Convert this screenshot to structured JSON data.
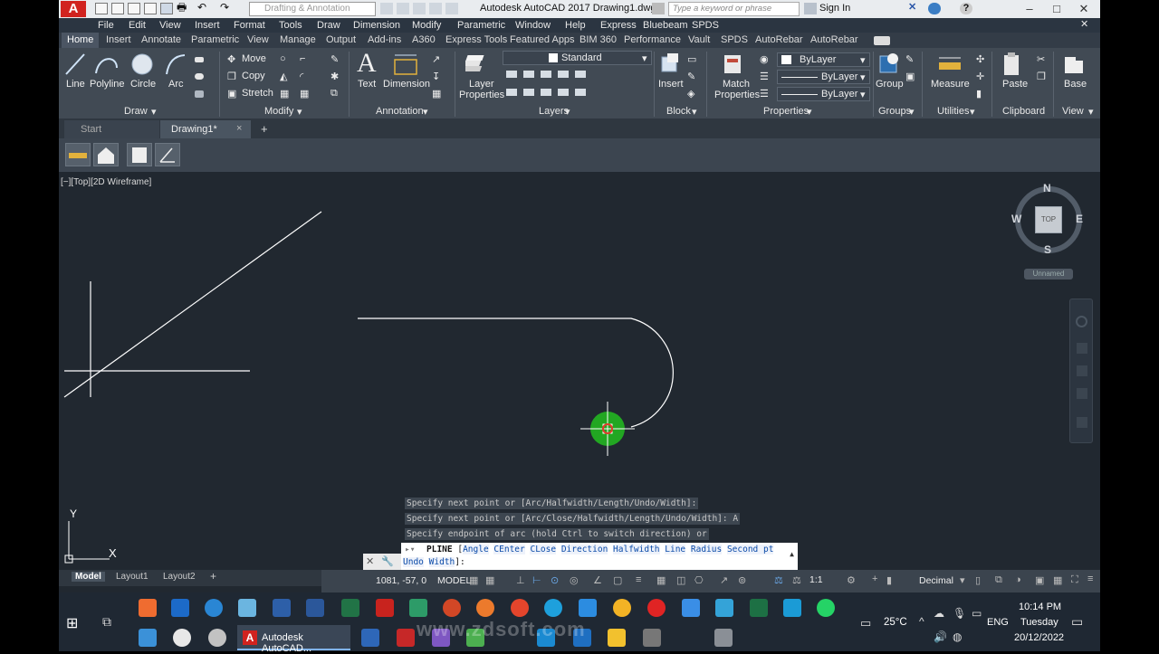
{
  "window": {
    "app_logo": "A",
    "title": "Autodesk AutoCAD 2017   Drawing1.dwg",
    "workspace": "Drafting & Annotation",
    "search_placeholder": "Type a keyword or phrase",
    "signin": "Sign In",
    "controls": [
      "–",
      "□",
      "✕"
    ]
  },
  "menubar": [
    "File",
    "Edit",
    "View",
    "Insert",
    "Format",
    "Tools",
    "Draw",
    "Dimension",
    "Modify",
    "Parametric",
    "Window",
    "Help",
    "Express",
    "Bluebeam",
    "SPDS"
  ],
  "ribbon_tabs": [
    "Home",
    "Insert",
    "Annotate",
    "Parametric",
    "View",
    "Manage",
    "Output",
    "Add-ins",
    "A360",
    "Express Tools",
    "Featured Apps",
    "BIM 360",
    "Performance",
    "Vault",
    "SPDS",
    "AutoRebar",
    "AutoRebar"
  ],
  "ribbon": {
    "draw": {
      "title": "Draw",
      "tools": [
        "Line",
        "Polyline",
        "Circle",
        "Arc"
      ]
    },
    "modify": {
      "title": "Modify",
      "tools": [
        "Move",
        "Copy",
        "Stretch"
      ]
    },
    "annotation": {
      "title": "Annotation",
      "tools": [
        "Text",
        "Dimension"
      ]
    },
    "layers": {
      "title": "Layers",
      "tool": "Layer",
      "tool2": "Properties",
      "layer_name": "Standard"
    },
    "block": {
      "title": "Block",
      "tool": "Insert"
    },
    "properties": {
      "title": "Properties",
      "tool": "Match",
      "tool2": "Properties",
      "color": "ByLayer",
      "linetype": "ByLayer",
      "lineweight": "ByLayer"
    },
    "groups": {
      "title": "Groups",
      "tool": "Group"
    },
    "utilities": {
      "title": "Utilities",
      "tool": "Measure"
    },
    "clipboard": {
      "title": "Clipboard",
      "tool": "Paste"
    },
    "view": {
      "title": "View",
      "tool": "Base"
    }
  },
  "file_tabs": {
    "start": "Start",
    "drawing": "Drawing1*",
    "close": "×",
    "add": "+"
  },
  "viewport": {
    "label": "[−][Top][2D Wireframe]",
    "viewcube": {
      "n": "N",
      "s": "S",
      "e": "E",
      "w": "W",
      "face": "TOP",
      "ucs": "Unnamed"
    },
    "ucs_axis": {
      "x": "X",
      "y": "Y"
    }
  },
  "command": {
    "history": [
      "Specify next point or [Arc/Halfwidth/Length/Undo/Width]:",
      "Specify next point or [Arc/Close/Halfwidth/Length/Undo/Width]: A",
      "Specify endpoint of arc (hold Ctrl to switch direction) or"
    ],
    "prompt": "PLINE",
    "options": [
      "Angle",
      "CEnter",
      "CLose",
      "Direction",
      "Halfwidth",
      "Line",
      "Radius",
      "Second pt"
    ],
    "options_line2": [
      "Undo",
      "Width"
    ],
    "suffix": "]:"
  },
  "layout_tabs": [
    "Model",
    "Layout1",
    "Layout2",
    "+"
  ],
  "status": {
    "coords": "1081, -57, 0",
    "space": "MODEL",
    "scale": "1:1",
    "units": "Decimal"
  },
  "taskbar": {
    "autocad_label": "Autodesk AutoCAD...",
    "weather": "25°C",
    "lang": "ENG",
    "time": "10:14 PM",
    "day": "Tuesday",
    "date": "20/12/2022",
    "watermark": "www.zdsoft.com"
  },
  "colors": {
    "canvas": "#212830",
    "ribbon": "#414a54",
    "accent_red": "#d1231f",
    "cursor_green": "#22a722"
  }
}
